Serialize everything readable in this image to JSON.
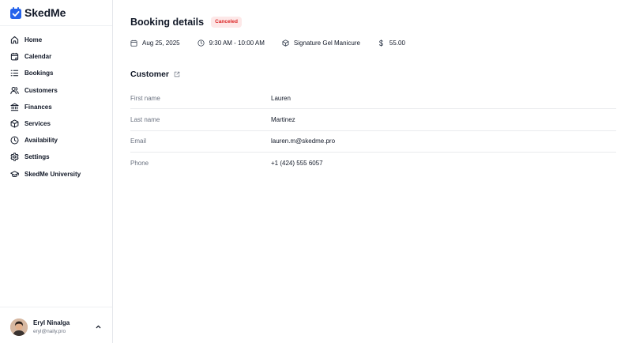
{
  "app": {
    "name": "SkedMe",
    "accent_color": "#2563eb"
  },
  "sidebar": {
    "items": [
      {
        "label": "Home",
        "icon": "home-icon"
      },
      {
        "label": "Calendar",
        "icon": "calendar-icon"
      },
      {
        "label": "Bookings",
        "icon": "list-icon"
      },
      {
        "label": "Customers",
        "icon": "users-icon"
      },
      {
        "label": "Finances",
        "icon": "bank-icon"
      },
      {
        "label": "Services",
        "icon": "box-icon"
      },
      {
        "label": "Availability",
        "icon": "clock-icon"
      },
      {
        "label": "Settings",
        "icon": "gear-icon"
      },
      {
        "label": "SkedMe University",
        "icon": "graduation-cap-icon"
      }
    ]
  },
  "user": {
    "name": "Eryl Ninalga",
    "email": "eryl@naily.pro"
  },
  "booking": {
    "title": "Booking details",
    "status": "Canceled",
    "status_color": "#dc2626",
    "date": "Aug 25, 2025",
    "time": "9:30 AM - 10:00 AM",
    "service": "Signature Gel Manicure",
    "price": "55.00"
  },
  "customer": {
    "section_title": "Customer",
    "fields": [
      {
        "label": "First name",
        "value": "Lauren"
      },
      {
        "label": "Last name",
        "value": "Martinez"
      },
      {
        "label": "Email",
        "value": "lauren.m@skedme.pro"
      },
      {
        "label": "Phone",
        "value": "+1 (424) 555 6057"
      }
    ]
  }
}
